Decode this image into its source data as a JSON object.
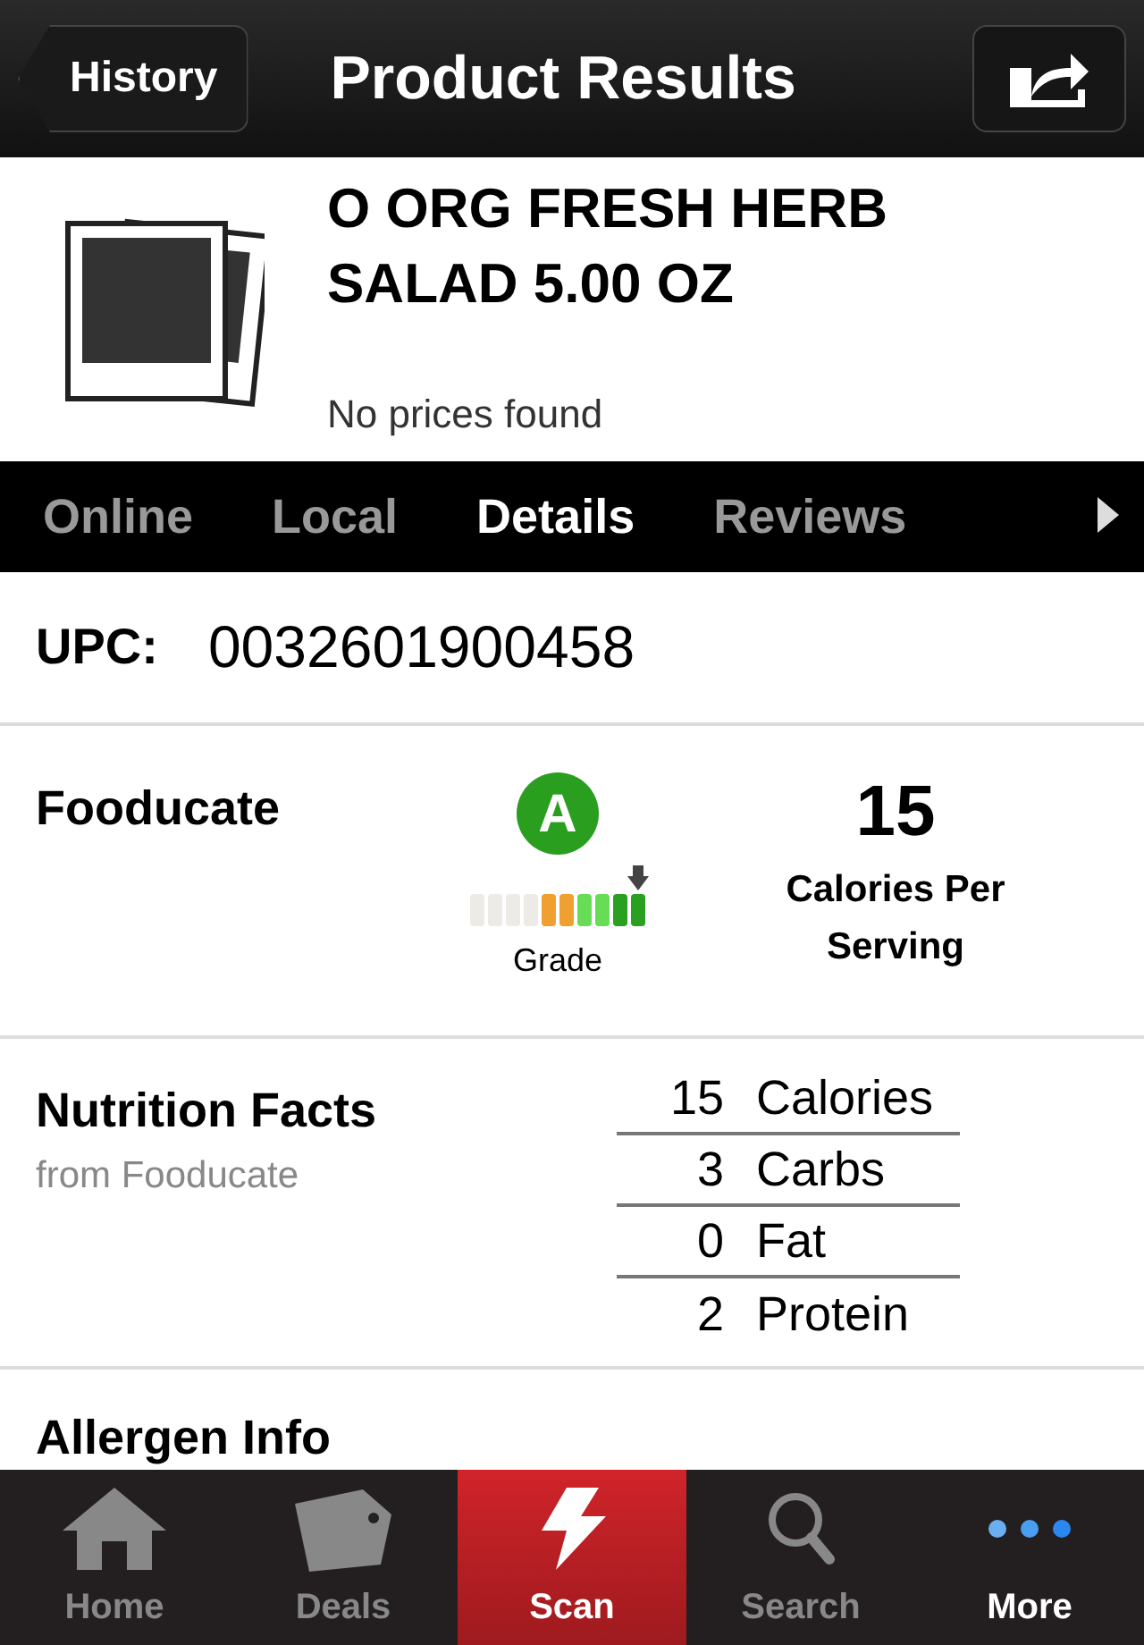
{
  "nav_bar": {
    "back_button": "History",
    "title": "Product Results"
  },
  "product": {
    "name": "O ORG FRESH HERB SALAD 5.00 OZ",
    "price_note": "No prices found"
  },
  "tabs": [
    {
      "label": "Online",
      "selected": false
    },
    {
      "label": "Local",
      "selected": false
    },
    {
      "label": "Details",
      "selected": true
    },
    {
      "label": "Reviews",
      "selected": false
    }
  ],
  "upc": {
    "label": "UPC:",
    "value": "0032601900458"
  },
  "fooducate": {
    "label": "Fooducate",
    "grade_letter": "A",
    "grade_label": "Grade",
    "grade_scale": [
      {
        "color": "#ecebe6",
        "selected": false
      },
      {
        "color": "#ecebe6",
        "selected": false
      },
      {
        "color": "#ecebe6",
        "selected": false
      },
      {
        "color": "#ecebe6",
        "selected": false
      },
      {
        "color": "#f0a030",
        "selected": false
      },
      {
        "color": "#f0a030",
        "selected": false
      },
      {
        "color": "#66dd55",
        "selected": false
      },
      {
        "color": "#66dd55",
        "selected": false
      },
      {
        "color": "#2aa020",
        "selected": false
      },
      {
        "color": "#2aa020",
        "selected": true
      }
    ],
    "calories": "15",
    "calories_label": "Calories Per Serving"
  },
  "nutrition": {
    "title": "Nutrition Facts",
    "source": "from Fooducate",
    "rows": [
      {
        "value": "15",
        "name": "Calories"
      },
      {
        "value": "3",
        "name": "Carbs"
      },
      {
        "value": "0",
        "name": "Fat"
      },
      {
        "value": "2",
        "name": "Protein"
      }
    ]
  },
  "allergen": {
    "title": "Allergen Info"
  },
  "tab_bar": [
    {
      "kind": "home",
      "label": "Home",
      "selected": false
    },
    {
      "kind": "deals",
      "label": "Deals",
      "selected": false
    },
    {
      "kind": "scan",
      "label": "Scan",
      "selected": true
    },
    {
      "kind": "search",
      "label": "Search",
      "selected": false
    },
    {
      "kind": "more",
      "label": "More",
      "selected": false
    }
  ]
}
